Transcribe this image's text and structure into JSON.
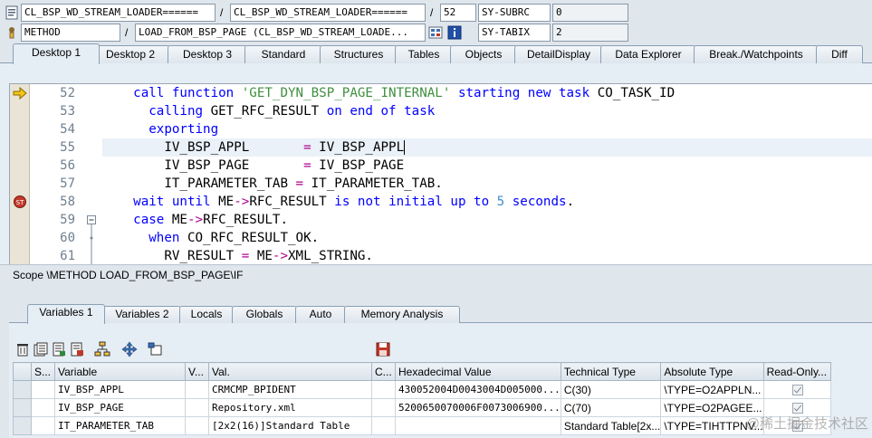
{
  "header": {
    "row1": {
      "program": "CL_BSP_WD_STREAM_LOADER======",
      "include": "CL_BSP_WD_STREAM_LOADER======",
      "line": "52",
      "sysfield": "SY-SUBRC",
      "sysvalue": "0"
    },
    "row2": {
      "event_type": "METHOD",
      "event": "LOAD_FROM_BSP_PAGE (CL_BSP_WD_STREAM_LOADE...",
      "sysfield": "SY-TABIX",
      "sysvalue": "2"
    },
    "separator": "/"
  },
  "desktop_tabs": [
    "Desktop 1",
    "Desktop 2",
    "Desktop 3",
    "Standard",
    "Structures",
    "Tables",
    "Objects",
    "DetailDisplay",
    "Data Explorer",
    "Break./Watchpoints",
    "Diff"
  ],
  "code": {
    "line_numbers": [
      "52",
      "53",
      "54",
      "55",
      "56",
      "57",
      "58",
      "59",
      "60",
      "61"
    ],
    "current_line": "52",
    "breakpoint_line": "58"
  },
  "scope": "Scope \\METHOD LOAD_FROM_BSP_PAGE\\IF",
  "variable_tabs": [
    "Variables 1",
    "Variables 2",
    "Locals",
    "Globals",
    "Auto",
    "Memory Analysis"
  ],
  "table": {
    "columns": [
      "S...",
      "Variable",
      "V...",
      "Val.",
      "C...",
      "Hexadecimal Value",
      "Technical Type",
      "Absolute Type",
      "Read-Only..."
    ],
    "rows": [
      {
        "variable": "IV_BSP_APPL",
        "value": "CRMCMP_BPIDENT",
        "hex": "430052004D0043004D005000...",
        "technical": "C(30)",
        "absolute": "\\TYPE=O2APPLN..."
      },
      {
        "variable": "IV_BSP_PAGE",
        "value": "Repository.xml",
        "hex": "5200650070006F0073006900...",
        "technical": "C(70)",
        "absolute": "\\TYPE=O2PAGEE..."
      },
      {
        "variable": "IT_PARAMETER_TAB",
        "value": "[2x2(16)]Standard Table",
        "hex": "",
        "technical": "Standard Table[2x...",
        "absolute": "\\TYPE=TIHTTPNV..."
      }
    ]
  },
  "watermark": "@稀土掘金技术社区",
  "icons": {
    "program": "program-icon",
    "event": "method-icon",
    "display_source": "display-source-icon",
    "info": "info-icon",
    "toolbar": [
      "delete-icon",
      "delete-all-icon",
      "open-icon",
      "export-icon",
      "hierarchy-icon",
      "move-icon",
      "new-tool-icon",
      "save-icon"
    ]
  }
}
